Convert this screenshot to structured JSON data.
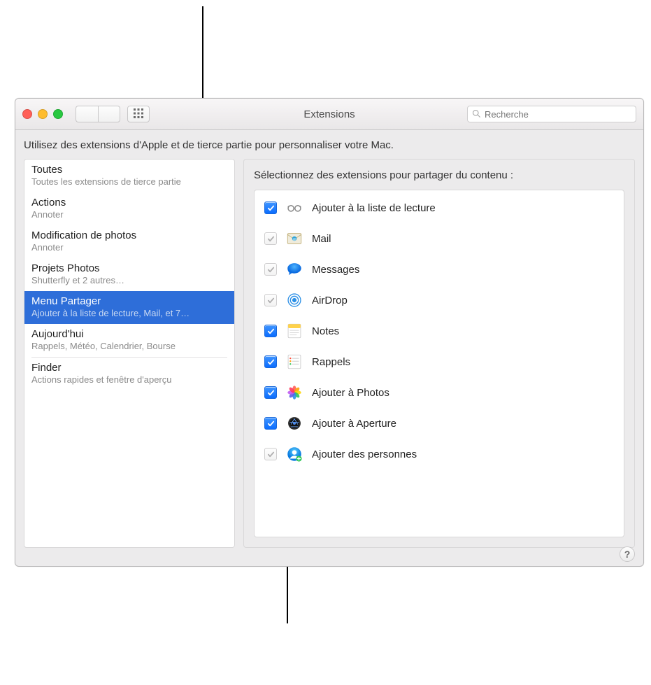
{
  "toolbar": {
    "title": "Extensions",
    "search_placeholder": "Recherche"
  },
  "description": "Utilisez des extensions d'Apple et de tierce partie pour personnaliser votre Mac.",
  "sidebar": {
    "items": [
      {
        "title": "Toutes",
        "subtitle": "Toutes les extensions de tierce partie"
      },
      {
        "title": "Actions",
        "subtitle": "Annoter"
      },
      {
        "title": "Modification de photos",
        "subtitle": "Annoter"
      },
      {
        "title": "Projets Photos",
        "subtitle": "Shutterfly et 2 autres…"
      },
      {
        "title": "Menu Partager",
        "subtitle": "Ajouter à la liste de lecture, Mail, et 7…",
        "selected": true
      },
      {
        "title": "Aujourd'hui",
        "subtitle": "Rappels, Météo, Calendrier, Bourse"
      },
      {
        "title": "Finder",
        "subtitle": "Actions rapides et fenêtre d'aperçu"
      }
    ]
  },
  "main": {
    "heading": "Sélectionnez des extensions pour partager du contenu :",
    "rows": [
      {
        "name": "Ajouter à la liste de lecture",
        "icon": "glasses",
        "check": "blue"
      },
      {
        "name": "Mail",
        "icon": "mail",
        "check": "grey"
      },
      {
        "name": "Messages",
        "icon": "messages",
        "check": "grey"
      },
      {
        "name": "AirDrop",
        "icon": "airdrop",
        "check": "grey"
      },
      {
        "name": "Notes",
        "icon": "notes",
        "check": "blue"
      },
      {
        "name": "Rappels",
        "icon": "reminders",
        "check": "blue"
      },
      {
        "name": "Ajouter à Photos",
        "icon": "photos",
        "check": "blue"
      },
      {
        "name": "Ajouter à Aperture",
        "icon": "aperture",
        "check": "blue"
      },
      {
        "name": "Ajouter des personnes",
        "icon": "people",
        "check": "grey"
      }
    ]
  },
  "help_label": "?"
}
